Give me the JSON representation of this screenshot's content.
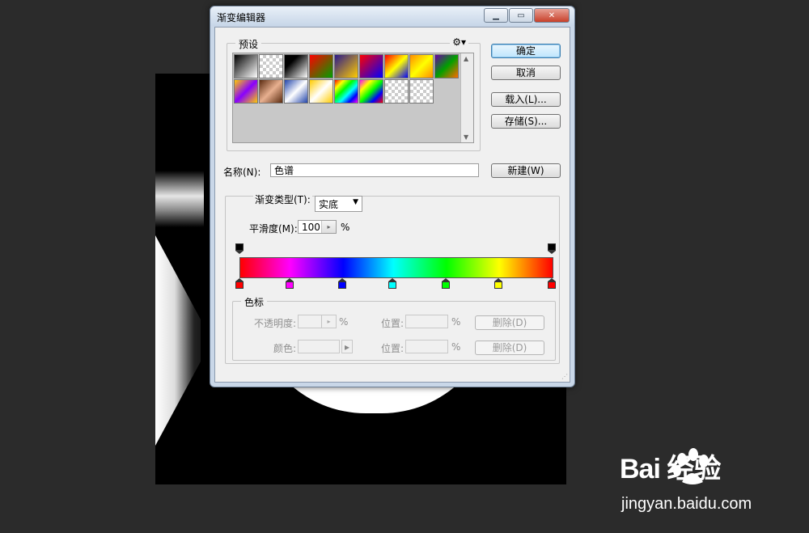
{
  "dialog": {
    "title": "渐变编辑器",
    "buttons": {
      "ok": "确定",
      "cancel": "取消",
      "load": "载入(L)...",
      "save": "存储(S)...",
      "new": "新建(W)"
    },
    "presets": {
      "label": "预设",
      "gear_icon": "gear-icon",
      "swatches": [
        {
          "bg": "linear-gradient(135deg,#000,#fff)"
        },
        {
          "bg": "checker"
        },
        {
          "bg": "linear-gradient(135deg,#000 30%,#fff)"
        },
        {
          "bg": "linear-gradient(135deg,#ff0000,#00a000)"
        },
        {
          "bg": "linear-gradient(135deg,#2b1a8c,#ffcc00)"
        },
        {
          "bg": "linear-gradient(135deg,#ff0000,#0000ff)"
        },
        {
          "bg": "linear-gradient(135deg,#ff0000,#ffff00,#0000ff)"
        },
        {
          "bg": "linear-gradient(135deg,#ff8c00,#ffff00,#ff8c00)"
        },
        {
          "bg": "linear-gradient(135deg,#6a00a8,#00a000,#ff6a00)"
        },
        {
          "bg": "linear-gradient(135deg,#ffcc00,#8800ff,#ffcc00)"
        },
        {
          "bg": "linear-gradient(135deg,#5a2b10,#e8b090,#5a2b10)"
        },
        {
          "bg": "linear-gradient(135deg,#2244aa,#ffffff,#2244aa)"
        },
        {
          "bg": "linear-gradient(135deg,#ffcc00,#ffffff,#ffcc00)"
        },
        {
          "bg": "linear-gradient(135deg,#ff0000,#ffff00,#00ff00,#00ffff,#0000ff,#ff00ff)"
        },
        {
          "bg": "linear-gradient(135deg,#ff00ff,#ffff00,#00ff00,#0000ff,#ff0000)"
        },
        {
          "bg": "checker"
        },
        {
          "bg": "checker"
        }
      ]
    },
    "name": {
      "label": "名称(N):",
      "value": "色谱"
    },
    "gradient_type": {
      "label": "渐变类型(T):",
      "value": "实底"
    },
    "smoothness": {
      "label": "平滑度(M):",
      "value": "100",
      "unit": "%"
    },
    "opacity_stops": [
      {
        "offset": 0,
        "color": "#000000"
      },
      {
        "offset": 100,
        "color": "#000000"
      }
    ],
    "color_stops": [
      {
        "offset": 0,
        "color": "#ff0000"
      },
      {
        "offset": 16,
        "color": "#ff00ff"
      },
      {
        "offset": 33,
        "color": "#0000ff"
      },
      {
        "offset": 49,
        "color": "#00ffff"
      },
      {
        "offset": 66,
        "color": "#00ff00"
      },
      {
        "offset": 83,
        "color": "#ffff00"
      },
      {
        "offset": 100,
        "color": "#ff0000"
      }
    ],
    "stops_group": {
      "label": "色标",
      "opacity_label": "不透明度:",
      "opacity_unit": "%",
      "position_label_1": "位置:",
      "position_unit_1": "%",
      "delete_1": "删除(D)",
      "color_label": "颜色:",
      "position_label_2": "位置:",
      "position_unit_2": "%",
      "delete_2": "删除(D)"
    }
  },
  "watermark": {
    "logo_text": "Bai  经验",
    "url": "jingyan.baidu.com"
  }
}
